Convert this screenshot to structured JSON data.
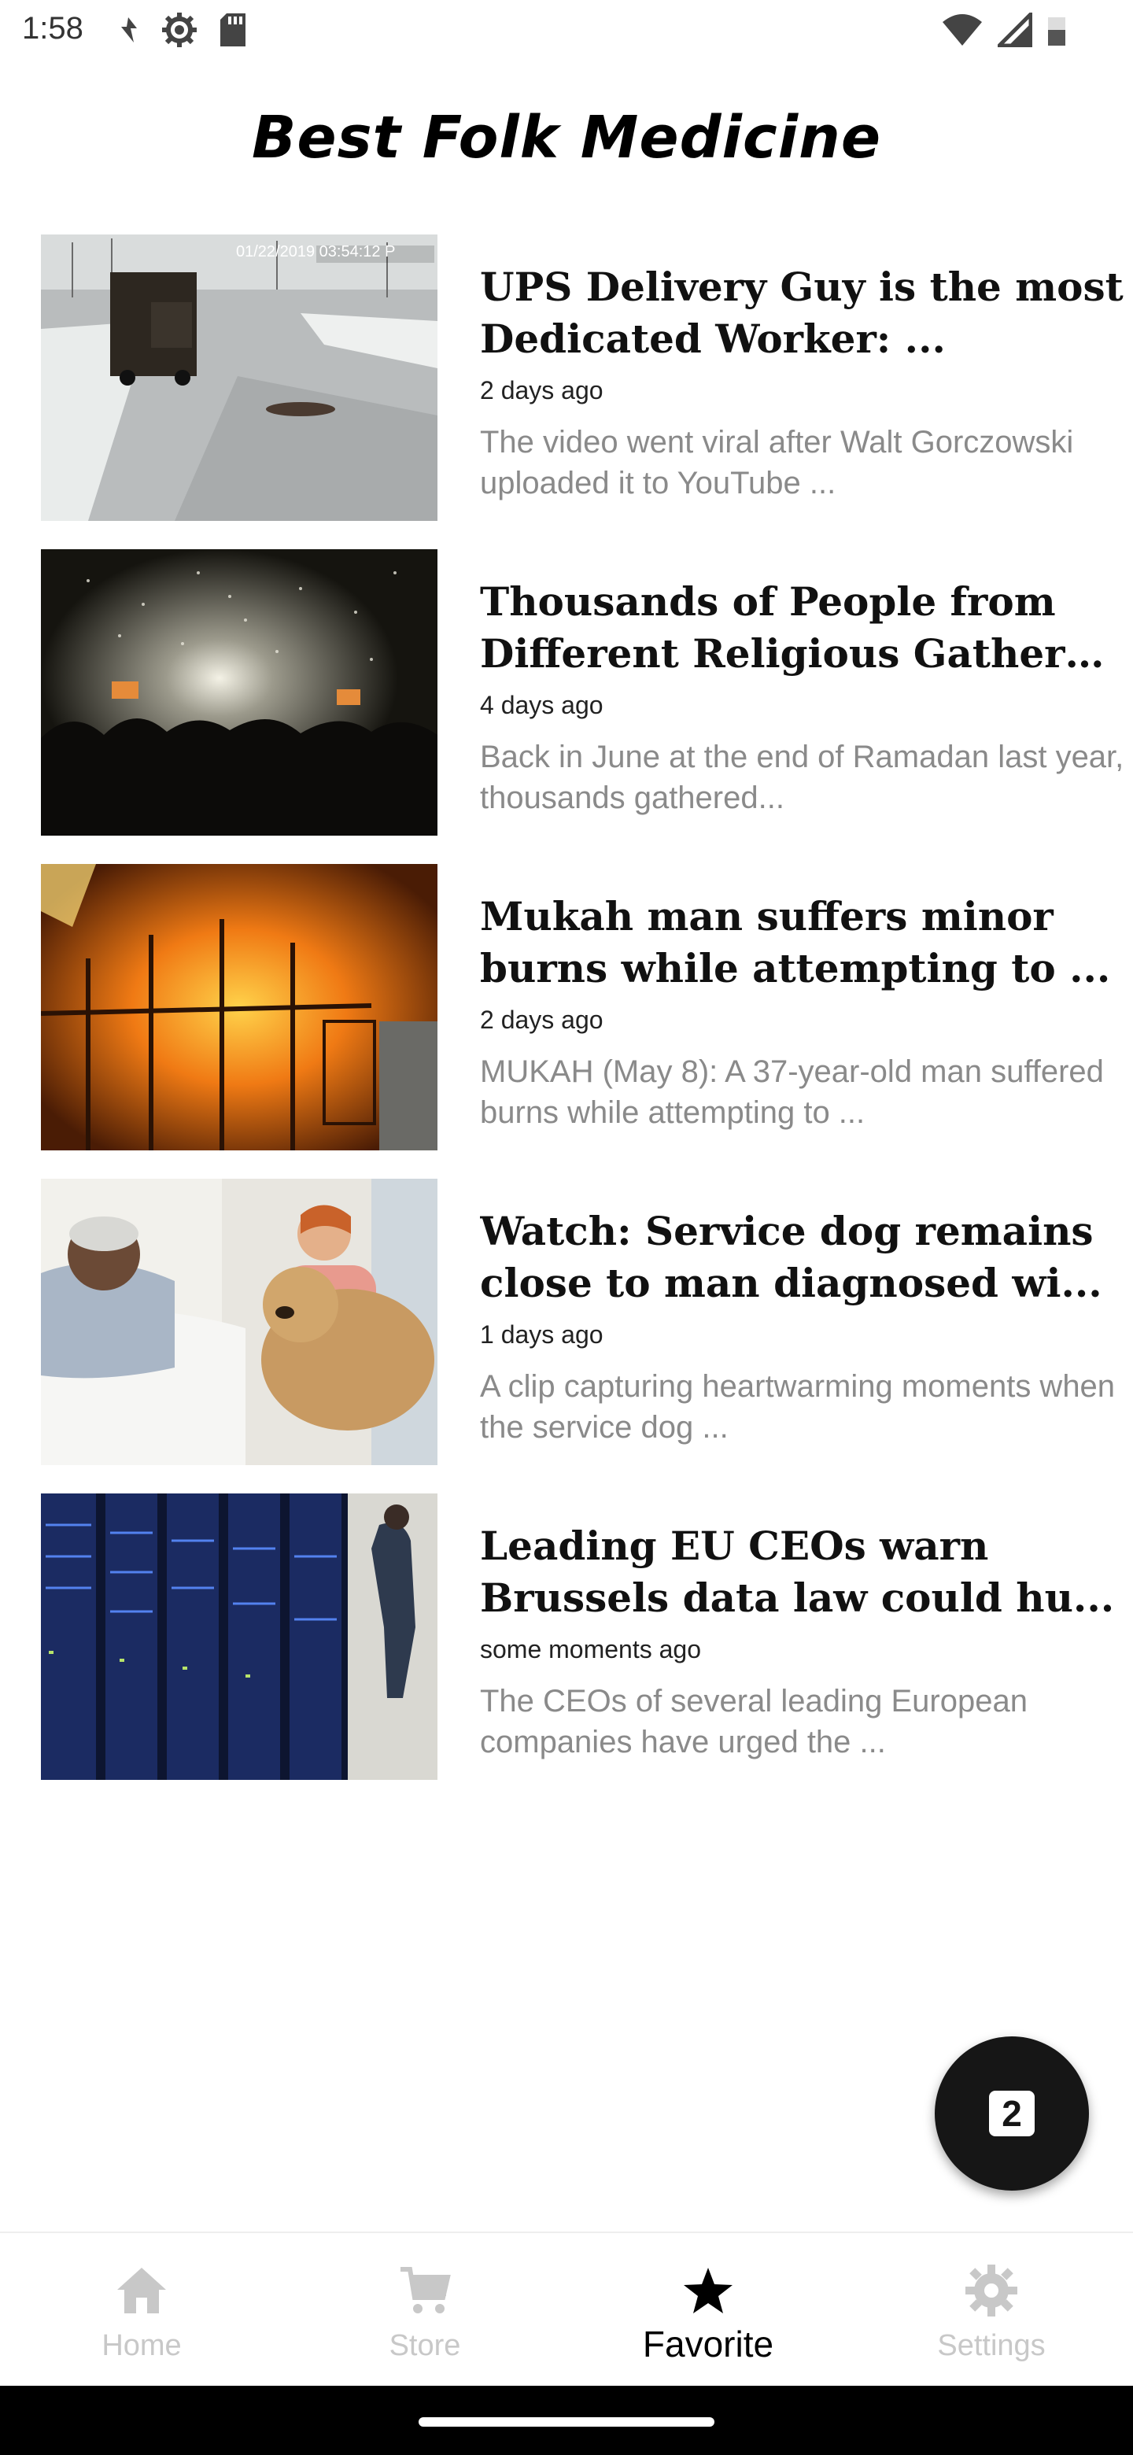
{
  "status_bar": {
    "time": "1:58"
  },
  "app": {
    "title": "Best Folk Medicine"
  },
  "news": [
    {
      "title": "UPS Delivery Guy is the most Dedicated Worker: ...",
      "time": "2 days ago",
      "excerpt": "The video went viral after Walt Gorczowski uploaded it to YouTube ...",
      "image_caption": "01/22/2019 03:54:12 P",
      "image_icon": "delivery-truck-photo"
    },
    {
      "title": "Thousands of People from Different Religious Gather t...",
      "time": "4 days ago",
      "excerpt": "Back in June at the end of Ramadan last year, thousands gathered...",
      "image_icon": "concert-crowd-photo"
    },
    {
      "title": "Mukah man suffers minor burns while attempting to ...",
      "time": "2 days ago",
      "excerpt": "MUKAH (May 8): A 37-year-old man suffered burns while attempting to ...",
      "image_icon": "house-fire-photo"
    },
    {
      "title": "Watch: Service dog remains close to man diagnosed wi...",
      "time": "1 days ago",
      "excerpt": "A clip capturing heartwarming moments when the service dog ...",
      "image_icon": "hospital-dog-photo"
    },
    {
      "title": "Leading EU CEOs warn Brussels data law could hu...",
      "time": "some moments ago",
      "excerpt": "The CEOs of several leading European companies have urged the ...",
      "image_icon": "server-room-photo"
    }
  ],
  "fab": {
    "count": "2"
  },
  "bottom_nav": [
    {
      "label": "Home",
      "icon": "home-icon",
      "active": false
    },
    {
      "label": "Store",
      "icon": "cart-icon",
      "active": false
    },
    {
      "label": "Favorite",
      "icon": "star-icon",
      "active": true
    },
    {
      "label": "Settings",
      "icon": "gear-icon",
      "active": false
    }
  ],
  "colors": {
    "active": "#000000",
    "inactive": "#c8c8c8",
    "excerpt": "#8a8a8a",
    "fab": "#161616"
  }
}
